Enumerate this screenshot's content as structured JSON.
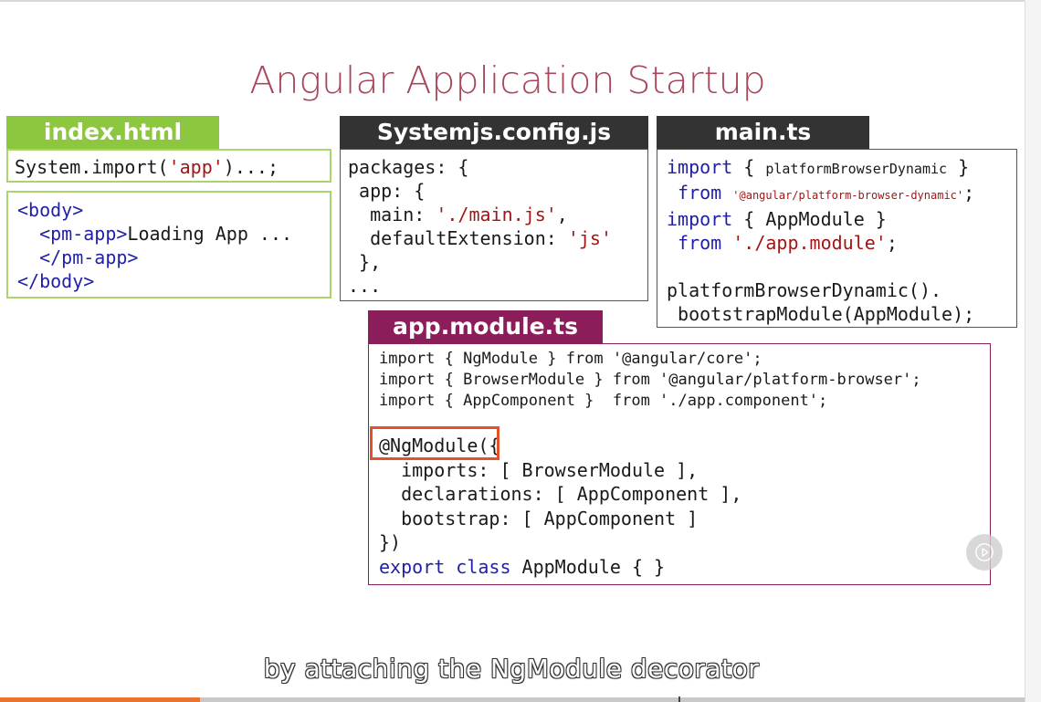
{
  "slide": {
    "title": "Angular Application Startup",
    "panels": {
      "index": {
        "tab": "index.html",
        "tab_color": "#8dc63f",
        "system_import": {
          "pre": "System.import(",
          "str": "'app'",
          "post": ")...;"
        },
        "body_open": "<body>",
        "pm_open": "<pm-app>",
        "loading": "Loading App ...",
        "pm_close": "</pm-app>",
        "body_close": "</body>"
      },
      "systemjs": {
        "tab": "Systemjs.config.js",
        "tab_color": "#333333",
        "l1": "packages: {",
        "l2": " app: {",
        "l3_key": "  main: ",
        "l3_val": "'./main.js'",
        "l3_end": ",",
        "l4_key": "  defaultExtension: ",
        "l4_val": "'js'",
        "l5": " },",
        "l6": "..."
      },
      "main": {
        "tab": "main.ts",
        "tab_color": "#333333",
        "kw_import": "import",
        "l1_mid": " { ",
        "l1_name": "platformBrowserDynamic",
        "l1_end": " }",
        "kw_from": "from",
        "l2_str": "'@angular/platform-browser-dynamic'",
        "l2_end": ";",
        "l3_mid": " { AppModule }",
        "l4_str": "'./app.module'",
        "l4_end": ";",
        "l5": "platformBrowserDynamic().",
        "l6": " bootstrapModule(AppModule);"
      },
      "app_module": {
        "tab": "app.module.ts",
        "tab_color": "#8b1e5a",
        "import1": "import { NgModule } from '@angular/core';",
        "import2": "import { BrowserModule } from '@angular/platform-browser';",
        "import3": "import { AppComponent }  from './app.component';",
        "decorator": "@NgModule(",
        "brace_open": "{",
        "imports": "  imports: [ BrowserModule ],",
        "declarations": "  declarations: [ AppComponent ],",
        "bootstrap": "  bootstrap: [ AppComponent ]",
        "close": "})",
        "kw_export": "export",
        "kw_class": "class",
        "class_end": " AppModule { }"
      }
    },
    "highlight_color": "#e1532d"
  },
  "player": {
    "caption": "by attaching the NgModule decorator",
    "play_icon": "play-icon",
    "progress": 0.195,
    "marker": 0.662,
    "progress_color": "#e9742f"
  }
}
